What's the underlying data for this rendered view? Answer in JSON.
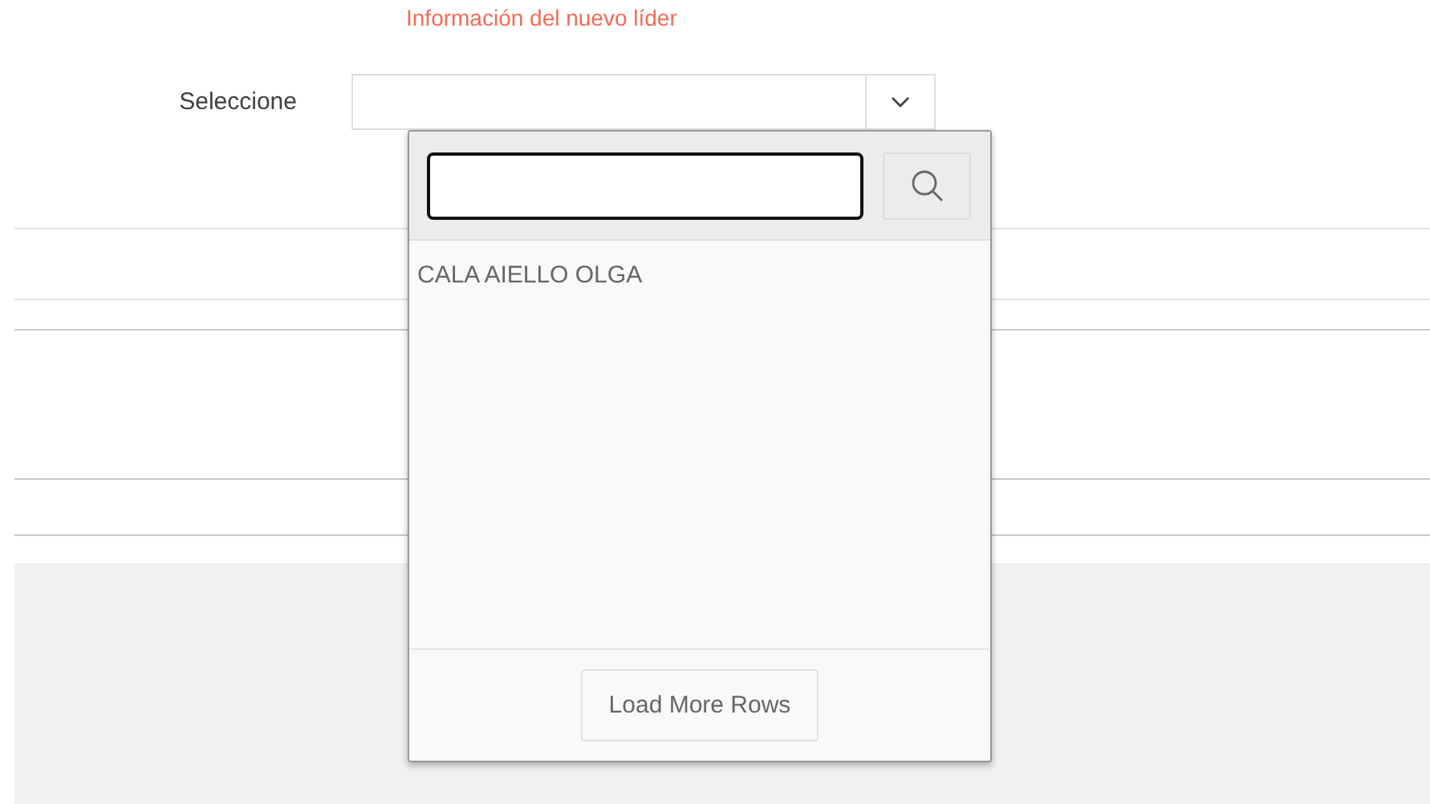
{
  "section_heading": "Información del nuevo líder",
  "field": {
    "label": "Seleccione"
  },
  "popup": {
    "options": [
      {
        "label": "CALA AIELLO OLGA",
        "selected": false
      }
    ],
    "load_more": "Load More Rows"
  }
}
